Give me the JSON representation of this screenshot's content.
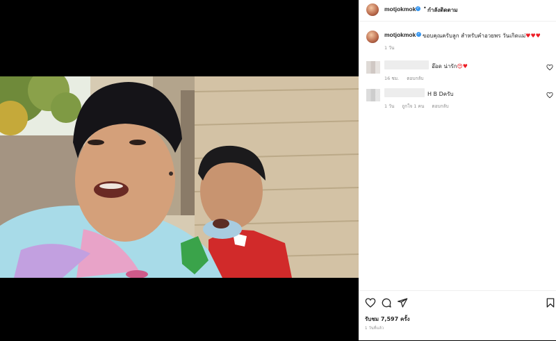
{
  "post": {
    "username": "motjokmok",
    "follow_dot": "•",
    "follow_label": "กำลังติดตาม",
    "caption": "ขอบคุณครับลูก สำหรับคำอวยพร วันเกิดแม่",
    "caption_hearts": "♥♥♥",
    "caption_time": "1 วัน"
  },
  "comments": [
    {
      "text": "อ๊อด น่ารัก",
      "emoji": "😍♥",
      "time": "16 ชม.",
      "reply": "ตอบกลับ"
    },
    {
      "text": "H B Dครับ",
      "time": "1 วัน",
      "likes": "ถูกใจ 1 คน",
      "reply": "ตอบกลับ"
    }
  ],
  "footer": {
    "views": "รับชม 7,597 ครั้ง",
    "time_ago": "1 วันที่แล้ว"
  },
  "icons": {
    "like": "heart-outline-icon",
    "comment": "speech-bubble-icon",
    "share": "paper-plane-icon",
    "save": "bookmark-icon",
    "verified": "verified-badge-icon"
  },
  "colors": {
    "verified": "#3897f0",
    "heart": "#ed1c24",
    "muted_text": "#8e8e8e",
    "primary_text": "#262626"
  }
}
